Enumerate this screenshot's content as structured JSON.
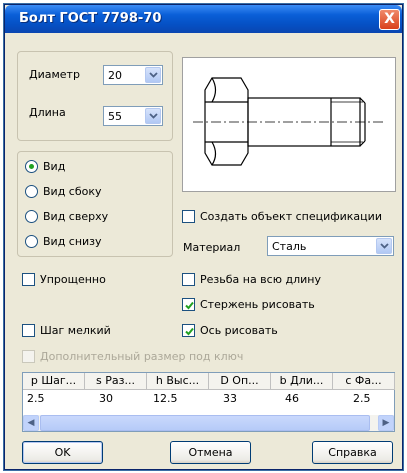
{
  "window": {
    "title": "Болт ГОСТ 7798-70",
    "close_glyph": "X"
  },
  "params": {
    "diameter_label": "Диаметр",
    "diameter_value": "20",
    "length_label": "Длина",
    "length_value": "55"
  },
  "view_options": [
    {
      "label": "Вид",
      "checked": true
    },
    {
      "label": "Вид сбоку",
      "checked": false
    },
    {
      "label": "Вид сверху",
      "checked": false
    },
    {
      "label": "Вид снизу",
      "checked": false
    }
  ],
  "spec": {
    "label": "Создать объект спецификации",
    "checked": false
  },
  "material": {
    "label": "Материал",
    "value": "Сталь"
  },
  "options": {
    "simplified": {
      "label": "Упрощенно",
      "checked": false
    },
    "full_thread": {
      "label": "Резьба на всю длину",
      "checked": false
    },
    "draw_rod": {
      "label": "Стержень рисовать",
      "checked": true
    },
    "fine_pitch": {
      "label": "Шаг мелкий",
      "checked": false
    },
    "draw_axis": {
      "label": "Ось рисовать",
      "checked": true
    },
    "extra_key": {
      "label": "Дополнительный размер под ключ",
      "checked": false,
      "disabled": true
    }
  },
  "table": {
    "columns": [
      "p Шаг...",
      "s Раз...",
      "h Выс...",
      "D Оп...",
      "b Дли...",
      "c Фа..."
    ],
    "row": [
      "2.5",
      "30",
      "12.5",
      "33",
      "46",
      "2.5"
    ]
  },
  "buttons": {
    "ok": "OK",
    "cancel": "Отмена",
    "help": "Справка"
  },
  "colors": {
    "title_bar": "#0a5fd8",
    "dialog_bg": "#ece9d8",
    "check_green": "#21a121"
  }
}
